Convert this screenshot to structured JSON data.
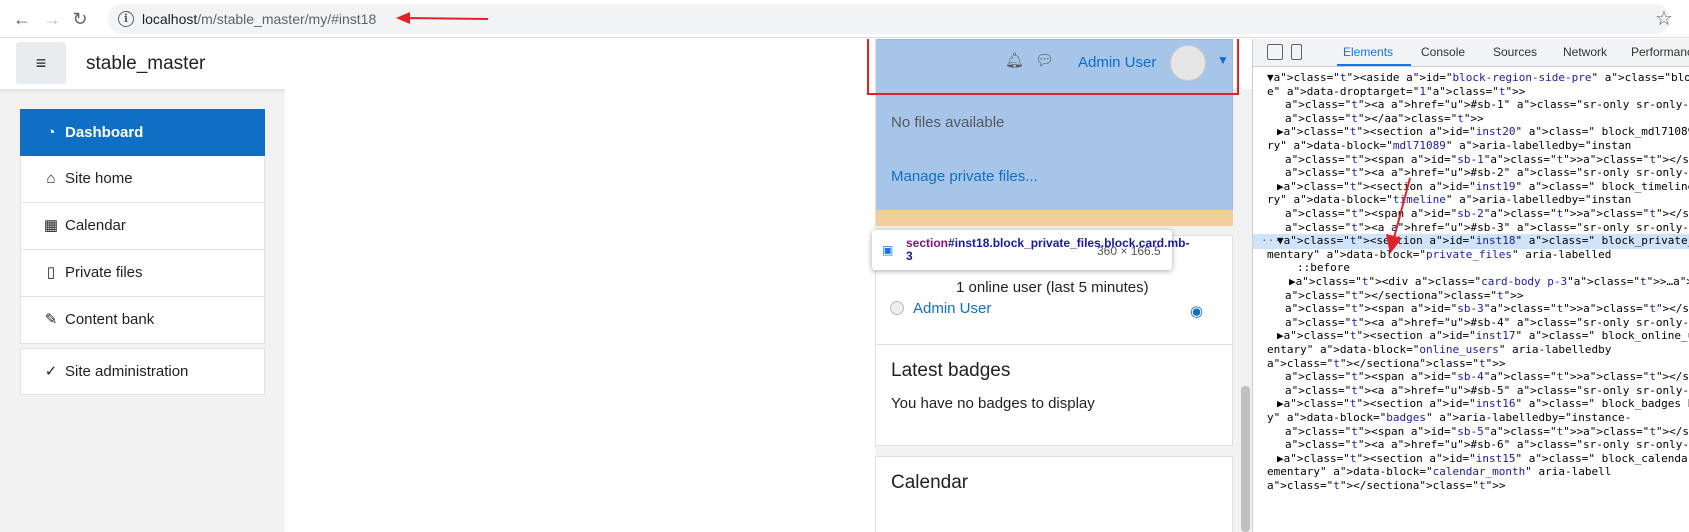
{
  "browser": {
    "url_host": "localhost",
    "url_path": "/m/stable_master/my/#inst18"
  },
  "site": {
    "title": "stable_master"
  },
  "nav": {
    "items": [
      {
        "label": "Dashboard",
        "icon": "dashboard-icon"
      },
      {
        "label": "Site home",
        "icon": "home-icon"
      },
      {
        "label": "Calendar",
        "icon": "calendar-icon"
      },
      {
        "label": "Private files",
        "icon": "file-icon"
      },
      {
        "label": "Content bank",
        "icon": "paintbrush-icon"
      },
      {
        "label": "Site administration",
        "icon": "wrench-icon"
      }
    ]
  },
  "usermenu": {
    "name": "Admin User"
  },
  "private_files": {
    "empty_text": "No files available",
    "manage_link": "Manage private files..."
  },
  "tooltip": {
    "tag": "section",
    "selector": "#inst18.block_private_files.block.card.mb-3",
    "size": "360 × 166.5"
  },
  "online_users": {
    "summary": "1 online user (last 5 minutes)",
    "user": "Admin User"
  },
  "badges": {
    "title": "Latest badges",
    "empty_text": "You have no badges to display"
  },
  "calendar": {
    "title": "Calendar"
  },
  "devtools": {
    "tabs": [
      "Elements",
      "Console",
      "Sources",
      "Network",
      "Performanc"
    ],
    "active_tab": "Elements",
    "lines": [
      "▼<aside id=\"block-region-side-pre\" class=\"block-re",
      "e\" data-droptarget=\"1\">",
      "<a href=\"#sb-1\" class=\"sr-only sr-only-focusabl",
      "</a>",
      "▶<section id=\"inst20\" class=\" block_mdl71089 bloc",
      "ry\" data-block=\"mdl71089\" aria-labelledby=\"instan",
      "<span id=\"sb-1\"></span>",
      "<a href=\"#sb-2\" class=\"sr-only sr-only-focusabl",
      "▶<section id=\"inst19\" class=\" block_timeline bloc",
      "ry\" data-block=\"timeline\" aria-labelledby=\"instan",
      "<span id=\"sb-2\"></span>",
      "<a href=\"#sb-3\" class=\"sr-only sr-only-focusabl",
      "▼<section id=\"inst18\" class=\" block_private_files",
      "mentary\" data-block=\"private_files\" aria-labelled",
      "::before",
      "▶<div class=\"card-body p-3\">…</div>",
      "</section>",
      "<span id=\"sb-3\"></span>",
      "<a href=\"#sb-4\" class=\"sr-only sr-only-focusabl",
      "▶<section id=\"inst17\" class=\" block_online_users",
      "entary\" data-block=\"online_users\" aria-labelledby",
      "</section>",
      "<span id=\"sb-4\"></span>",
      "<a href=\"#sb-5\" class=\"sr-only sr-only-focusabl",
      "▶<section id=\"inst16\" class=\" block_badges block",
      "y\" data-block=\"badges\" aria-labelledby=\"instance-",
      "<span id=\"sb-5\"></span>",
      "<a href=\"#sb-6\" class=\"sr-only sr-only-focusabl",
      "▶<section id=\"inst15\" class=\" block_calendar_mont",
      "ementary\" data-block=\"calendar_month\" aria-labell",
      "</section>"
    ]
  },
  "colors": {
    "accent": "#0f6fc5",
    "annotation_red": "#e0232a",
    "highlight_overlay": "#6fa1db",
    "padding_overlay": "#f3ce9d"
  }
}
